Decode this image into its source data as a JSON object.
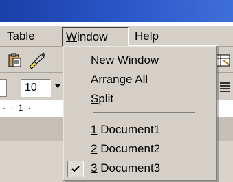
{
  "menubar": {
    "table": {
      "prefix": "T",
      "accel": "a",
      "rest": "ble"
    },
    "window": {
      "prefix": "",
      "accel": "W",
      "rest": "indow"
    },
    "help": {
      "prefix": "",
      "accel": "H",
      "rest": "elp"
    }
  },
  "toolbar": {
    "font_size": "10",
    "ruler_text": "· · 1 ·"
  },
  "window_menu": {
    "items": [
      {
        "accel": "N",
        "rest": "ew Window"
      },
      {
        "accel": "A",
        "rest": "rrange All"
      },
      {
        "accel": "S",
        "rest": "plit"
      },
      {
        "accel": "1",
        "rest": " Document1"
      },
      {
        "accel": "2",
        "rest": " Document2"
      },
      {
        "accel": "3",
        "rest": " Document3",
        "checked": true
      }
    ]
  },
  "icons": [
    "clipboard-icon",
    "brush-icon",
    "table-icon",
    "align-icon",
    "check-icon",
    "dropdown-arrow-icon"
  ]
}
